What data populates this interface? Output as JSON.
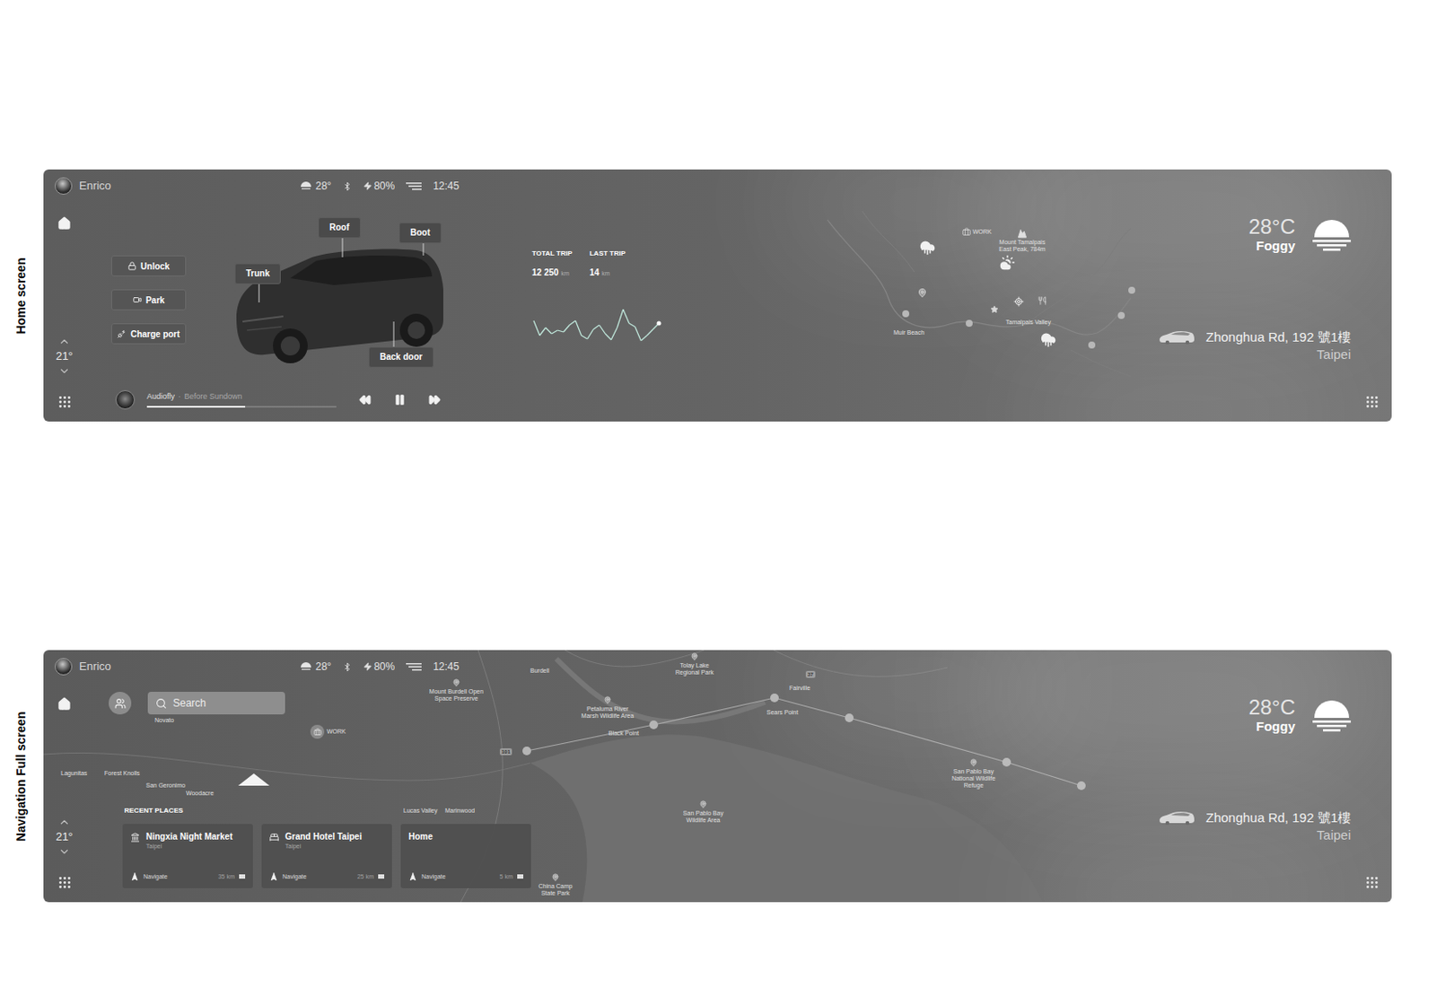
{
  "home_screen": {
    "label": "Home screen",
    "status_bar": {
      "user": "Enrico",
      "outside_temperature": "28°",
      "battery": "80%",
      "time": "12:45"
    },
    "cabin": {
      "temperature": "21°"
    },
    "car_controls": [
      {
        "label": "Unlock"
      },
      {
        "label": "Park"
      },
      {
        "label": "Charge port"
      }
    ],
    "car_parts": [
      {
        "label": "Roof"
      },
      {
        "label": "Boot"
      },
      {
        "label": "Trunk"
      },
      {
        "label": "Back door"
      }
    ],
    "trips": [
      {
        "label": "TOTAL TRIP",
        "value": "12 250",
        "unit": "km"
      },
      {
        "label": "LAST TRIP",
        "value": "14",
        "unit": "km"
      }
    ],
    "trip_chart": {
      "values": [
        25,
        8,
        17,
        10,
        14,
        12,
        20,
        25,
        8,
        4,
        15,
        20,
        10,
        3,
        17,
        38,
        22,
        18,
        2,
        8,
        15,
        22
      ]
    },
    "map": {
      "labels": [
        "WORK",
        "Mount Tamalpais East Peak, 784m",
        "Tamalpais Valley",
        "Muir Beach"
      ]
    },
    "media": {
      "artist": "Audiofly",
      "separator": "·",
      "track": "Before Sundown",
      "level": 0.52,
      "playing": true
    },
    "weather": {
      "temperature": "28°C",
      "condition": "Foggy"
    },
    "location": {
      "address": "Zhonghua Rd, 192 號1樓",
      "city": "Taipei"
    }
  },
  "navigation_screen": {
    "label": "Navigation Full screen",
    "status_bar": {
      "user": "Enrico",
      "outside_temperature": "28°",
      "battery": "80%",
      "time": "12:45"
    },
    "cabin": {
      "temperature": "21°"
    },
    "search": {
      "placeholder": "Search"
    },
    "recent_places": {
      "title": "RECENT PLACES",
      "items": [
        {
          "name": "Ningxia Night Market",
          "city": "Taipei",
          "action": "Navigate",
          "distance": "35 km"
        },
        {
          "name": "Grand Hotel Taipei",
          "city": "Taipei",
          "action": "Navigate",
          "distance": "25 km"
        },
        {
          "name": "Home",
          "action": "Navigate",
          "distance": "5 km"
        }
      ]
    },
    "map": {
      "labels": [
        "Mount Burdell Open Space Preserve",
        "Burdell",
        "Tolay Lake Regional Park",
        "Fairville",
        "Petaluma River Marsh Wildlife Area",
        "Black Point",
        "Sears Point",
        "WORK",
        "Lagunitas",
        "Forest Knolls",
        "San Geronimo",
        "Woodacre",
        "Lucas Valley",
        "Marinwood",
        "San Pablo Bay Wildlife Area",
        "China Camp State Park",
        "San Pablo Bay National Wildlife Refuge",
        "Novato"
      ],
      "shields": [
        "101",
        "37"
      ]
    },
    "weather": {
      "temperature": "28°C",
      "condition": "Foggy"
    },
    "location": {
      "address": "Zhonghua Rd, 192 號1樓",
      "city": "Taipei"
    }
  }
}
